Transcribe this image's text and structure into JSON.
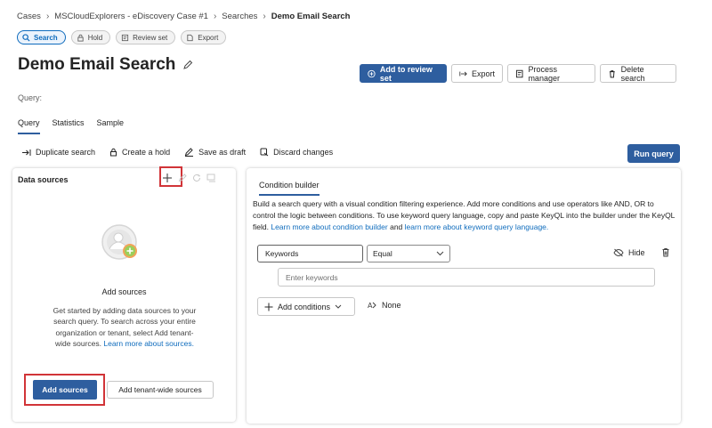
{
  "breadcrumb": {
    "items": [
      "Cases",
      "MSCloudExplorers - eDiscovery Case #1",
      "Searches"
    ],
    "current": "Demo Email Search"
  },
  "pills": [
    {
      "label": "Search",
      "icon": "search-icon",
      "active": true
    },
    {
      "label": "Hold",
      "icon": "lock-icon",
      "active": false
    },
    {
      "label": "Review set",
      "icon": "review-set-icon",
      "active": false
    },
    {
      "label": "Export",
      "icon": "export-icon",
      "active": false
    }
  ],
  "page": {
    "title": "Demo Email Search",
    "query_label": "Query:"
  },
  "top_buttons": {
    "add_to_review_set": "Add to review set",
    "export": "Export",
    "process_manager": "Process manager",
    "delete_search": "Delete search"
  },
  "tabs": [
    "Query",
    "Statistics",
    "Sample"
  ],
  "actions": {
    "duplicate": "Duplicate search",
    "create_hold": "Create a hold",
    "save_draft": "Save as draft",
    "discard": "Discard changes",
    "run_query": "Run query"
  },
  "data_sources": {
    "title": "Data sources",
    "empty_title": "Add sources",
    "empty_desc": "Get started by adding data sources to your search query. To search across your entire organization or tenant, select Add tenant-wide sources.",
    "learn_more": "Learn more about sources.",
    "add_sources": "Add sources",
    "add_tenant_wide": "Add tenant-wide sources"
  },
  "condition_builder": {
    "tab": "Condition builder",
    "desc": "Build a search query with a visual condition filtering experience. Add more conditions and use operators like AND, OR to control the logic between conditions. To use keyword query language, copy and paste KeyQL into the builder under the KeyQL field.",
    "link1": "Learn more about condition builder",
    "and_text": "and",
    "link2": "learn more about keyword query language.",
    "keywords_label": "Keywords",
    "operator": "Equal",
    "hide": "Hide",
    "keywords_placeholder": "Enter keywords",
    "add_conditions": "Add conditions",
    "none": "None"
  },
  "colors": {
    "primary": "#2e5e9f",
    "link": "#0f6cbd",
    "highlight": "#d13438"
  }
}
